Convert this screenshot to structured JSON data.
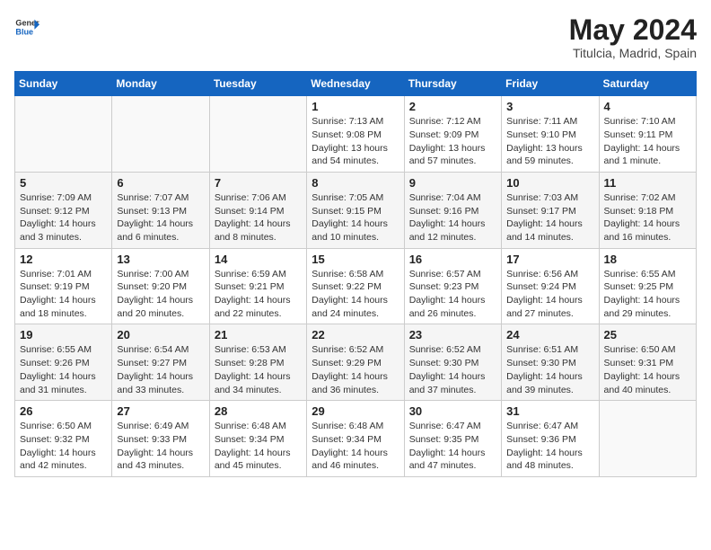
{
  "header": {
    "logo_line1": "General",
    "logo_line2": "Blue",
    "main_title": "May 2024",
    "subtitle": "Titulcia, Madrid, Spain"
  },
  "days_of_week": [
    "Sunday",
    "Monday",
    "Tuesday",
    "Wednesday",
    "Thursday",
    "Friday",
    "Saturday"
  ],
  "weeks": [
    [
      {
        "day": "",
        "info": ""
      },
      {
        "day": "",
        "info": ""
      },
      {
        "day": "",
        "info": ""
      },
      {
        "day": "1",
        "info": "Sunrise: 7:13 AM\nSunset: 9:08 PM\nDaylight: 13 hours and 54 minutes."
      },
      {
        "day": "2",
        "info": "Sunrise: 7:12 AM\nSunset: 9:09 PM\nDaylight: 13 hours and 57 minutes."
      },
      {
        "day": "3",
        "info": "Sunrise: 7:11 AM\nSunset: 9:10 PM\nDaylight: 13 hours and 59 minutes."
      },
      {
        "day": "4",
        "info": "Sunrise: 7:10 AM\nSunset: 9:11 PM\nDaylight: 14 hours and 1 minute."
      }
    ],
    [
      {
        "day": "5",
        "info": "Sunrise: 7:09 AM\nSunset: 9:12 PM\nDaylight: 14 hours and 3 minutes."
      },
      {
        "day": "6",
        "info": "Sunrise: 7:07 AM\nSunset: 9:13 PM\nDaylight: 14 hours and 6 minutes."
      },
      {
        "day": "7",
        "info": "Sunrise: 7:06 AM\nSunset: 9:14 PM\nDaylight: 14 hours and 8 minutes."
      },
      {
        "day": "8",
        "info": "Sunrise: 7:05 AM\nSunset: 9:15 PM\nDaylight: 14 hours and 10 minutes."
      },
      {
        "day": "9",
        "info": "Sunrise: 7:04 AM\nSunset: 9:16 PM\nDaylight: 14 hours and 12 minutes."
      },
      {
        "day": "10",
        "info": "Sunrise: 7:03 AM\nSunset: 9:17 PM\nDaylight: 14 hours and 14 minutes."
      },
      {
        "day": "11",
        "info": "Sunrise: 7:02 AM\nSunset: 9:18 PM\nDaylight: 14 hours and 16 minutes."
      }
    ],
    [
      {
        "day": "12",
        "info": "Sunrise: 7:01 AM\nSunset: 9:19 PM\nDaylight: 14 hours and 18 minutes."
      },
      {
        "day": "13",
        "info": "Sunrise: 7:00 AM\nSunset: 9:20 PM\nDaylight: 14 hours and 20 minutes."
      },
      {
        "day": "14",
        "info": "Sunrise: 6:59 AM\nSunset: 9:21 PM\nDaylight: 14 hours and 22 minutes."
      },
      {
        "day": "15",
        "info": "Sunrise: 6:58 AM\nSunset: 9:22 PM\nDaylight: 14 hours and 24 minutes."
      },
      {
        "day": "16",
        "info": "Sunrise: 6:57 AM\nSunset: 9:23 PM\nDaylight: 14 hours and 26 minutes."
      },
      {
        "day": "17",
        "info": "Sunrise: 6:56 AM\nSunset: 9:24 PM\nDaylight: 14 hours and 27 minutes."
      },
      {
        "day": "18",
        "info": "Sunrise: 6:55 AM\nSunset: 9:25 PM\nDaylight: 14 hours and 29 minutes."
      }
    ],
    [
      {
        "day": "19",
        "info": "Sunrise: 6:55 AM\nSunset: 9:26 PM\nDaylight: 14 hours and 31 minutes."
      },
      {
        "day": "20",
        "info": "Sunrise: 6:54 AM\nSunset: 9:27 PM\nDaylight: 14 hours and 33 minutes."
      },
      {
        "day": "21",
        "info": "Sunrise: 6:53 AM\nSunset: 9:28 PM\nDaylight: 14 hours and 34 minutes."
      },
      {
        "day": "22",
        "info": "Sunrise: 6:52 AM\nSunset: 9:29 PM\nDaylight: 14 hours and 36 minutes."
      },
      {
        "day": "23",
        "info": "Sunrise: 6:52 AM\nSunset: 9:30 PM\nDaylight: 14 hours and 37 minutes."
      },
      {
        "day": "24",
        "info": "Sunrise: 6:51 AM\nSunset: 9:30 PM\nDaylight: 14 hours and 39 minutes."
      },
      {
        "day": "25",
        "info": "Sunrise: 6:50 AM\nSunset: 9:31 PM\nDaylight: 14 hours and 40 minutes."
      }
    ],
    [
      {
        "day": "26",
        "info": "Sunrise: 6:50 AM\nSunset: 9:32 PM\nDaylight: 14 hours and 42 minutes."
      },
      {
        "day": "27",
        "info": "Sunrise: 6:49 AM\nSunset: 9:33 PM\nDaylight: 14 hours and 43 minutes."
      },
      {
        "day": "28",
        "info": "Sunrise: 6:48 AM\nSunset: 9:34 PM\nDaylight: 14 hours and 45 minutes."
      },
      {
        "day": "29",
        "info": "Sunrise: 6:48 AM\nSunset: 9:34 PM\nDaylight: 14 hours and 46 minutes."
      },
      {
        "day": "30",
        "info": "Sunrise: 6:47 AM\nSunset: 9:35 PM\nDaylight: 14 hours and 47 minutes."
      },
      {
        "day": "31",
        "info": "Sunrise: 6:47 AM\nSunset: 9:36 PM\nDaylight: 14 hours and 48 minutes."
      },
      {
        "day": "",
        "info": ""
      }
    ]
  ]
}
